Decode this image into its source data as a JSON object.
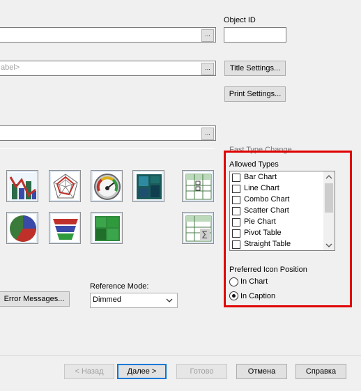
{
  "object_id": {
    "label": "Object ID",
    "value": ""
  },
  "fields": {
    "label_field": {
      "text": "abel>"
    },
    "dots": "..."
  },
  "buttons": {
    "title_settings": "Title Settings...",
    "print_settings": "Print Settings...",
    "error_messages": "Error Messages..."
  },
  "fast_type_change": {
    "title": "Fast Type Change",
    "allowed_types_label": "Allowed Types",
    "items": [
      "Bar Chart",
      "Line Chart",
      "Combo Chart",
      "Scatter Chart",
      "Pie Chart",
      "Pivot Table",
      "Straight Table"
    ],
    "preferred_label": "Preferred Icon Position",
    "options": [
      "In Chart",
      "In Caption"
    ],
    "selected_option": "In Caption",
    "highlight_color": "#e00000"
  },
  "reference_mode": {
    "label": "Reference Mode:",
    "value": "Dimmed"
  },
  "wizard": {
    "back": "< Назад",
    "next": "Далее >",
    "finish": "Готово",
    "cancel": "Отмена",
    "help": "Справка"
  },
  "chart_icons": [
    "combo-chart-icon",
    "radar-chart-icon",
    "gauge-chart-icon",
    "block-chart-icon",
    "pivot-table-icon",
    "pie-chart-icon",
    "funnel-chart-icon",
    "mekko-chart-icon",
    "straight-table-icon"
  ]
}
